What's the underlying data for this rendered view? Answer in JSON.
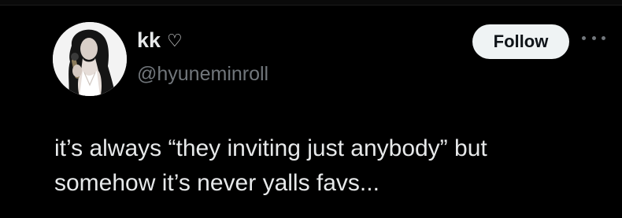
{
  "tweet": {
    "author": {
      "display_name": "kk",
      "display_name_icon": "heart-outline-icon",
      "handle": "@hyuneminroll",
      "avatar": "profile-photo"
    },
    "follow_label": "Follow",
    "more_icon": "more-options-icon",
    "text_lines": [
      "it’s always “they inviting just anybody” but",
      "somehow it’s never yalls favs..."
    ]
  },
  "colors": {
    "background": "#000000",
    "primary_text": "#e7e9ea",
    "secondary_text": "#71767b",
    "follow_button_bg": "#eff3f4",
    "follow_button_text": "#0f1419"
  }
}
